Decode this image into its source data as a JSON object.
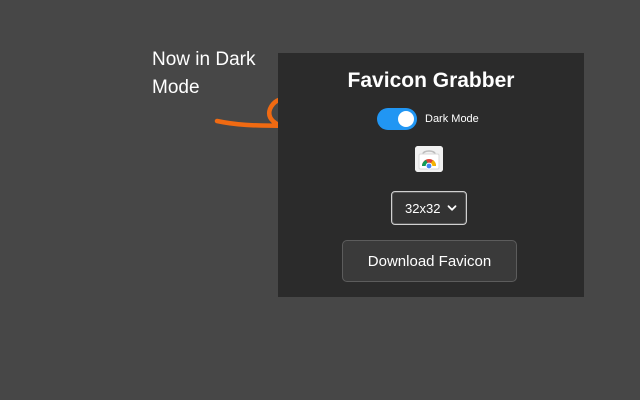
{
  "annotation": {
    "text": "Now in Dark Mode",
    "arrow_color": "#f06a12",
    "arrow_icon": "hand-drawn-loop-arrow"
  },
  "panel": {
    "title": "Favicon Grabber",
    "background": "#2b2b2b",
    "dark_mode_toggle": {
      "label": "Dark Mode",
      "state": "on",
      "color": "#2196f3"
    },
    "favicon_icon": "chrome-webstore-icon",
    "size_select": {
      "selected": "32x32"
    },
    "download_button": {
      "label": "Download Favicon"
    }
  },
  "colors": {
    "page_background": "#474747",
    "text": "#ffffff"
  }
}
